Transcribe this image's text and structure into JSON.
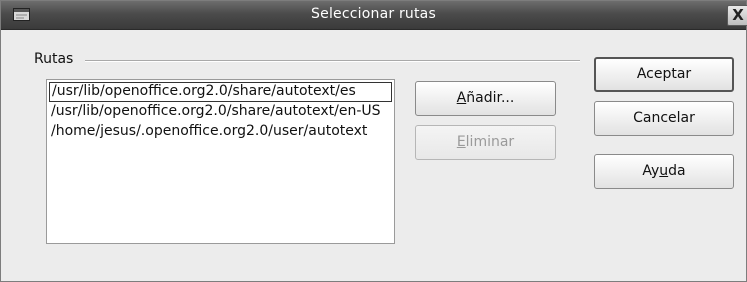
{
  "window": {
    "title": "Seleccionar rutas",
    "close_glyph": "X",
    "menu_icon": "window-menu-icon"
  },
  "section": {
    "label": "Rutas"
  },
  "paths": [
    "/usr/lib/openoffice.org2.0/share/autotext/es",
    "/usr/lib/openoffice.org2.0/share/autotext/en-US",
    "/home/jesus/.openoffice.org2.0/user/autotext"
  ],
  "selected_index": 0,
  "buttons": {
    "add": {
      "pre": "",
      "mnemonic": "A",
      "post": "ñadir..."
    },
    "remove": {
      "pre": "",
      "mnemonic": "E",
      "post": "liminar",
      "enabled": false
    },
    "accept": "Aceptar",
    "cancel": "Cancelar",
    "help": {
      "pre": "Ay",
      "mnemonic": "u",
      "post": "da"
    }
  },
  "colors": {
    "titlebar": "#4b4b4b",
    "dialog_bg": "#ececec",
    "disabled_text": "#9a9a9a"
  }
}
